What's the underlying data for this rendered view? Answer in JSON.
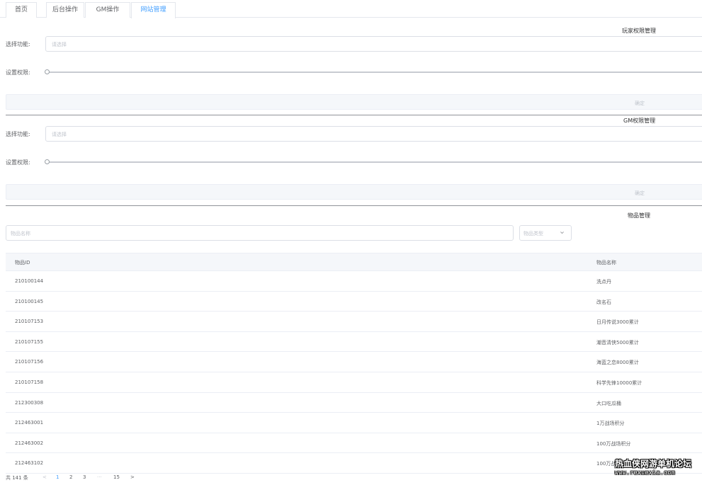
{
  "tabs": [
    {
      "label": "首页",
      "active": false
    },
    {
      "label": "后台操作",
      "active": false
    },
    {
      "label": "GM操作",
      "active": false
    },
    {
      "label": "网站管理",
      "active": true
    }
  ],
  "player_permissions": {
    "title": "玩家权限管理",
    "select_label": "选择功能:",
    "select_placeholder": "请选择",
    "permission_label": "设置权限:",
    "permission_value": 0,
    "confirm_label": "确定"
  },
  "gm_permissions": {
    "title": "GM权限管理",
    "select_label": "选择功能:",
    "select_placeholder": "请选择",
    "permission_label": "设置权限:",
    "permission_value": 0,
    "confirm_label": "确定"
  },
  "item_management": {
    "title": "物品管理",
    "name_placeholder": "物品名称",
    "type_placeholder": "物品类型",
    "columns": [
      "物品ID",
      "物品名称"
    ],
    "rows": [
      {
        "id": "210100144",
        "name": "洗点丹"
      },
      {
        "id": "210100145",
        "name": "改名石"
      },
      {
        "id": "210107153",
        "name": "日月传说3000累计"
      },
      {
        "id": "210107155",
        "name": "潮音清侠5000累计"
      },
      {
        "id": "210107156",
        "name": "海蓝之恋8000累计"
      },
      {
        "id": "210107158",
        "name": "科学先锋10000累计"
      },
      {
        "id": "212300308",
        "name": "大口吃瓜桶"
      },
      {
        "id": "212463001",
        "name": "1万战场积分"
      },
      {
        "id": "212463002",
        "name": "100万战场积分"
      },
      {
        "id": "212463102",
        "name": "100万战场积分"
      }
    ]
  },
  "pagination": {
    "total": "共 141 条",
    "prev": "<",
    "pages": [
      "1",
      "2",
      "3"
    ],
    "ellipsis": "···",
    "last": "15",
    "next": ">",
    "current": "1"
  },
  "watermark": {
    "line1": "热血侠网游单机论坛",
    "line2": "www.rexuexia.com"
  },
  "colors": {
    "accent": "#409eff",
    "border": "#dcdfe6",
    "text": "#606266",
    "placeholder": "#c0c4cc"
  }
}
